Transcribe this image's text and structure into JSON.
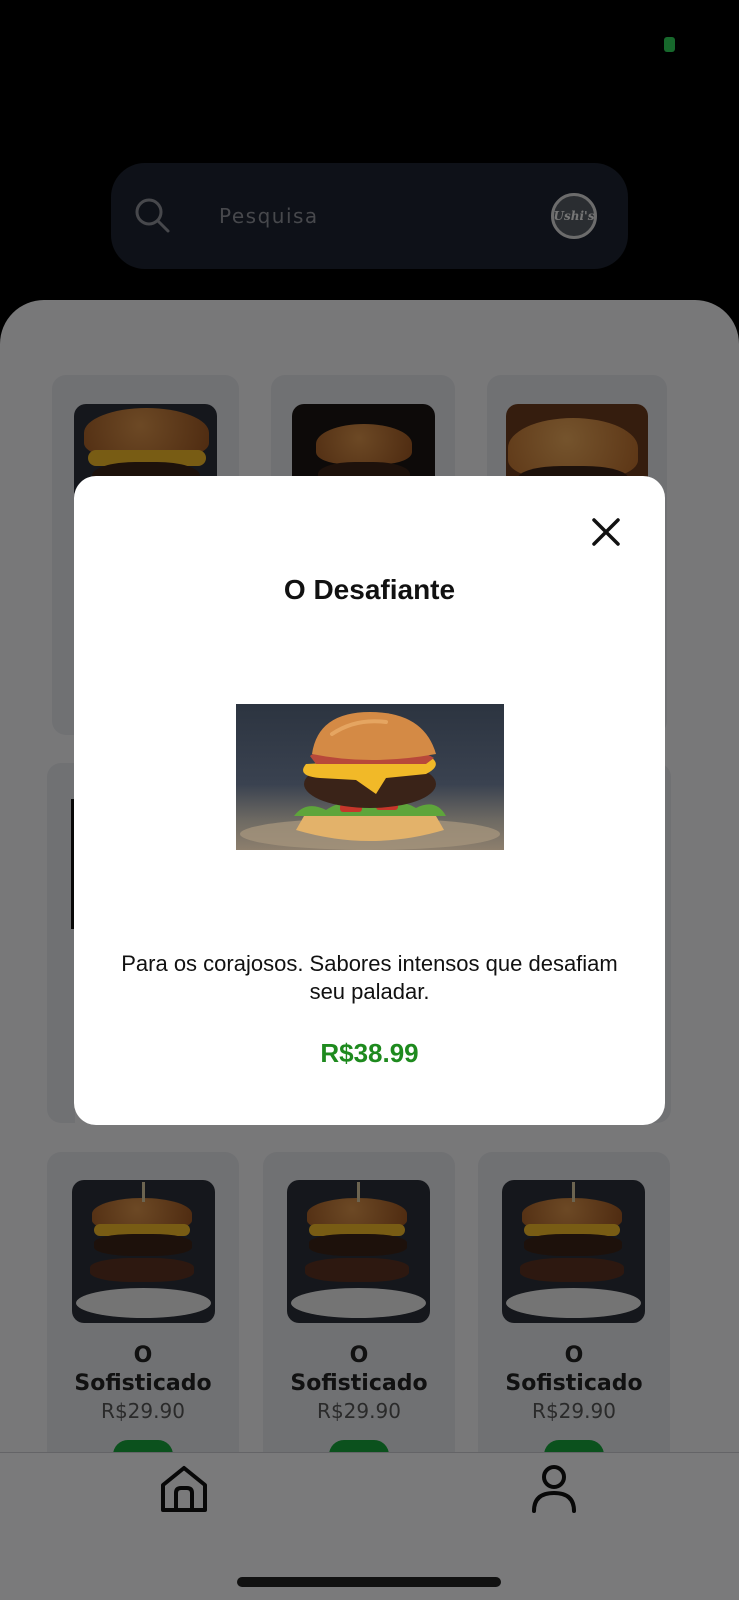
{
  "colors": {
    "accent_green": "#1e8a1e",
    "button_green": "#17a33b",
    "search_bg": "#1c2330"
  },
  "search": {
    "placeholder": "Pesquisa",
    "logo_text": "Ushi's"
  },
  "grid": {
    "row1": [
      {
        "image": "burger-bacon-cheese"
      },
      {
        "image": "burger-dark-bun"
      },
      {
        "image": "burger-sesame"
      }
    ],
    "row3": [
      {
        "name": "O\nSofisticado",
        "price": "R$29.90"
      },
      {
        "name": "O\nSofisticado",
        "price": "R$29.90"
      },
      {
        "name": "O\nSofisticado",
        "price": "R$29.90"
      }
    ]
  },
  "modal": {
    "title": "O Desafiante",
    "description": "Para os corajosos. Sabores intensos que desafiam seu paladar.",
    "price": "R$38.99",
    "close_icon": "close-icon"
  },
  "nav": {
    "items": [
      "home-icon",
      "profile-icon"
    ]
  }
}
